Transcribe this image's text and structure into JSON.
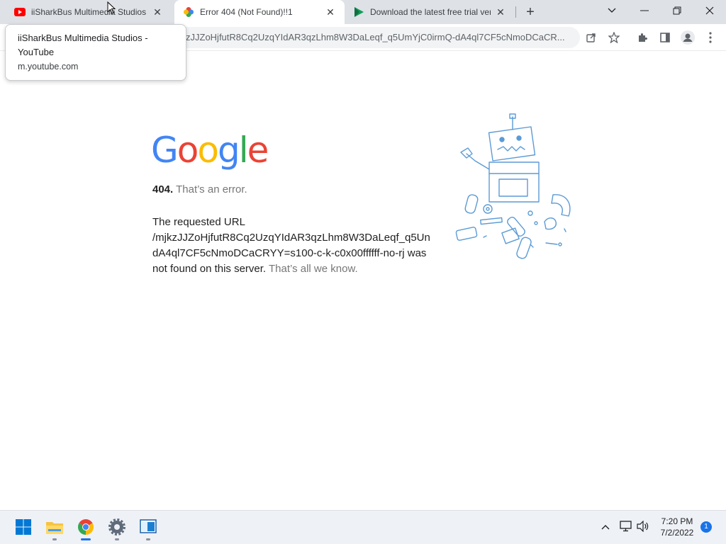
{
  "tabs": [
    {
      "title": "iiSharkBus Multimedia Studios - YouTube",
      "favicon": "youtube-icon",
      "close_label": "✕"
    },
    {
      "title": "Error 404 (Not Found)!!1",
      "favicon": "google-photos-icon",
      "close_label": "✕",
      "active": true
    },
    {
      "title": "Download the latest free trial versions",
      "favicon": "play-icon",
      "close_label": "✕"
    }
  ],
  "newtab_label": "+",
  "window_controls": {
    "dropdown": "⌄",
    "minimize": "—",
    "restore": "❐",
    "close": "✕"
  },
  "address_bar": {
    "url": "zJJZoHjfutR8Cq2UzqYIdAR3qzLhm8W3DaLeqf_q5UmYjC0irmQ-dA4ql7CF5cNmoDCaCR..."
  },
  "toolbar_icons": [
    "share-icon",
    "star-icon",
    "extensions-icon",
    "side-panel-icon",
    "profile-icon",
    "menu-icon"
  ],
  "tooltip": {
    "title": "iiSharkBus Multimedia Studios - YouTube",
    "domain": "m.youtube.com"
  },
  "page": {
    "logo": [
      "G",
      "o",
      "o",
      "g",
      "l",
      "e"
    ],
    "logo_colors": [
      "#4285f4",
      "#ea4335",
      "#fbbc05",
      "#4285f4",
      "#34a853",
      "#ea4335"
    ],
    "error_code": "404.",
    "error_text": "That’s an error.",
    "body_prefix": "The requested URL",
    "body_url_line1": "/mjkzJJZoHjfutR8Cq2UzqYIdAR3qzLhm8W3DaLeqf_q5Un",
    "body_url_line2": "dA4ql7CF5cNmoDCaCRYY=s100-c-k-c0x00ffffff-no-rj was",
    "body_end": "not found on this server.",
    "body_muted": "That’s all we know."
  },
  "taskbar": {
    "apps": [
      "windows-start-icon",
      "file-explorer-icon",
      "chrome-icon",
      "settings-icon",
      "app-icon"
    ],
    "tray": {
      "chevron": "^",
      "network": "network-icon",
      "volume": "volume-icon"
    },
    "time": "7:20 PM",
    "date": "7/2/2022",
    "notifications": "1"
  },
  "colors": {
    "accent": "#1a73e8",
    "tabstrip": "#dee1e6"
  }
}
